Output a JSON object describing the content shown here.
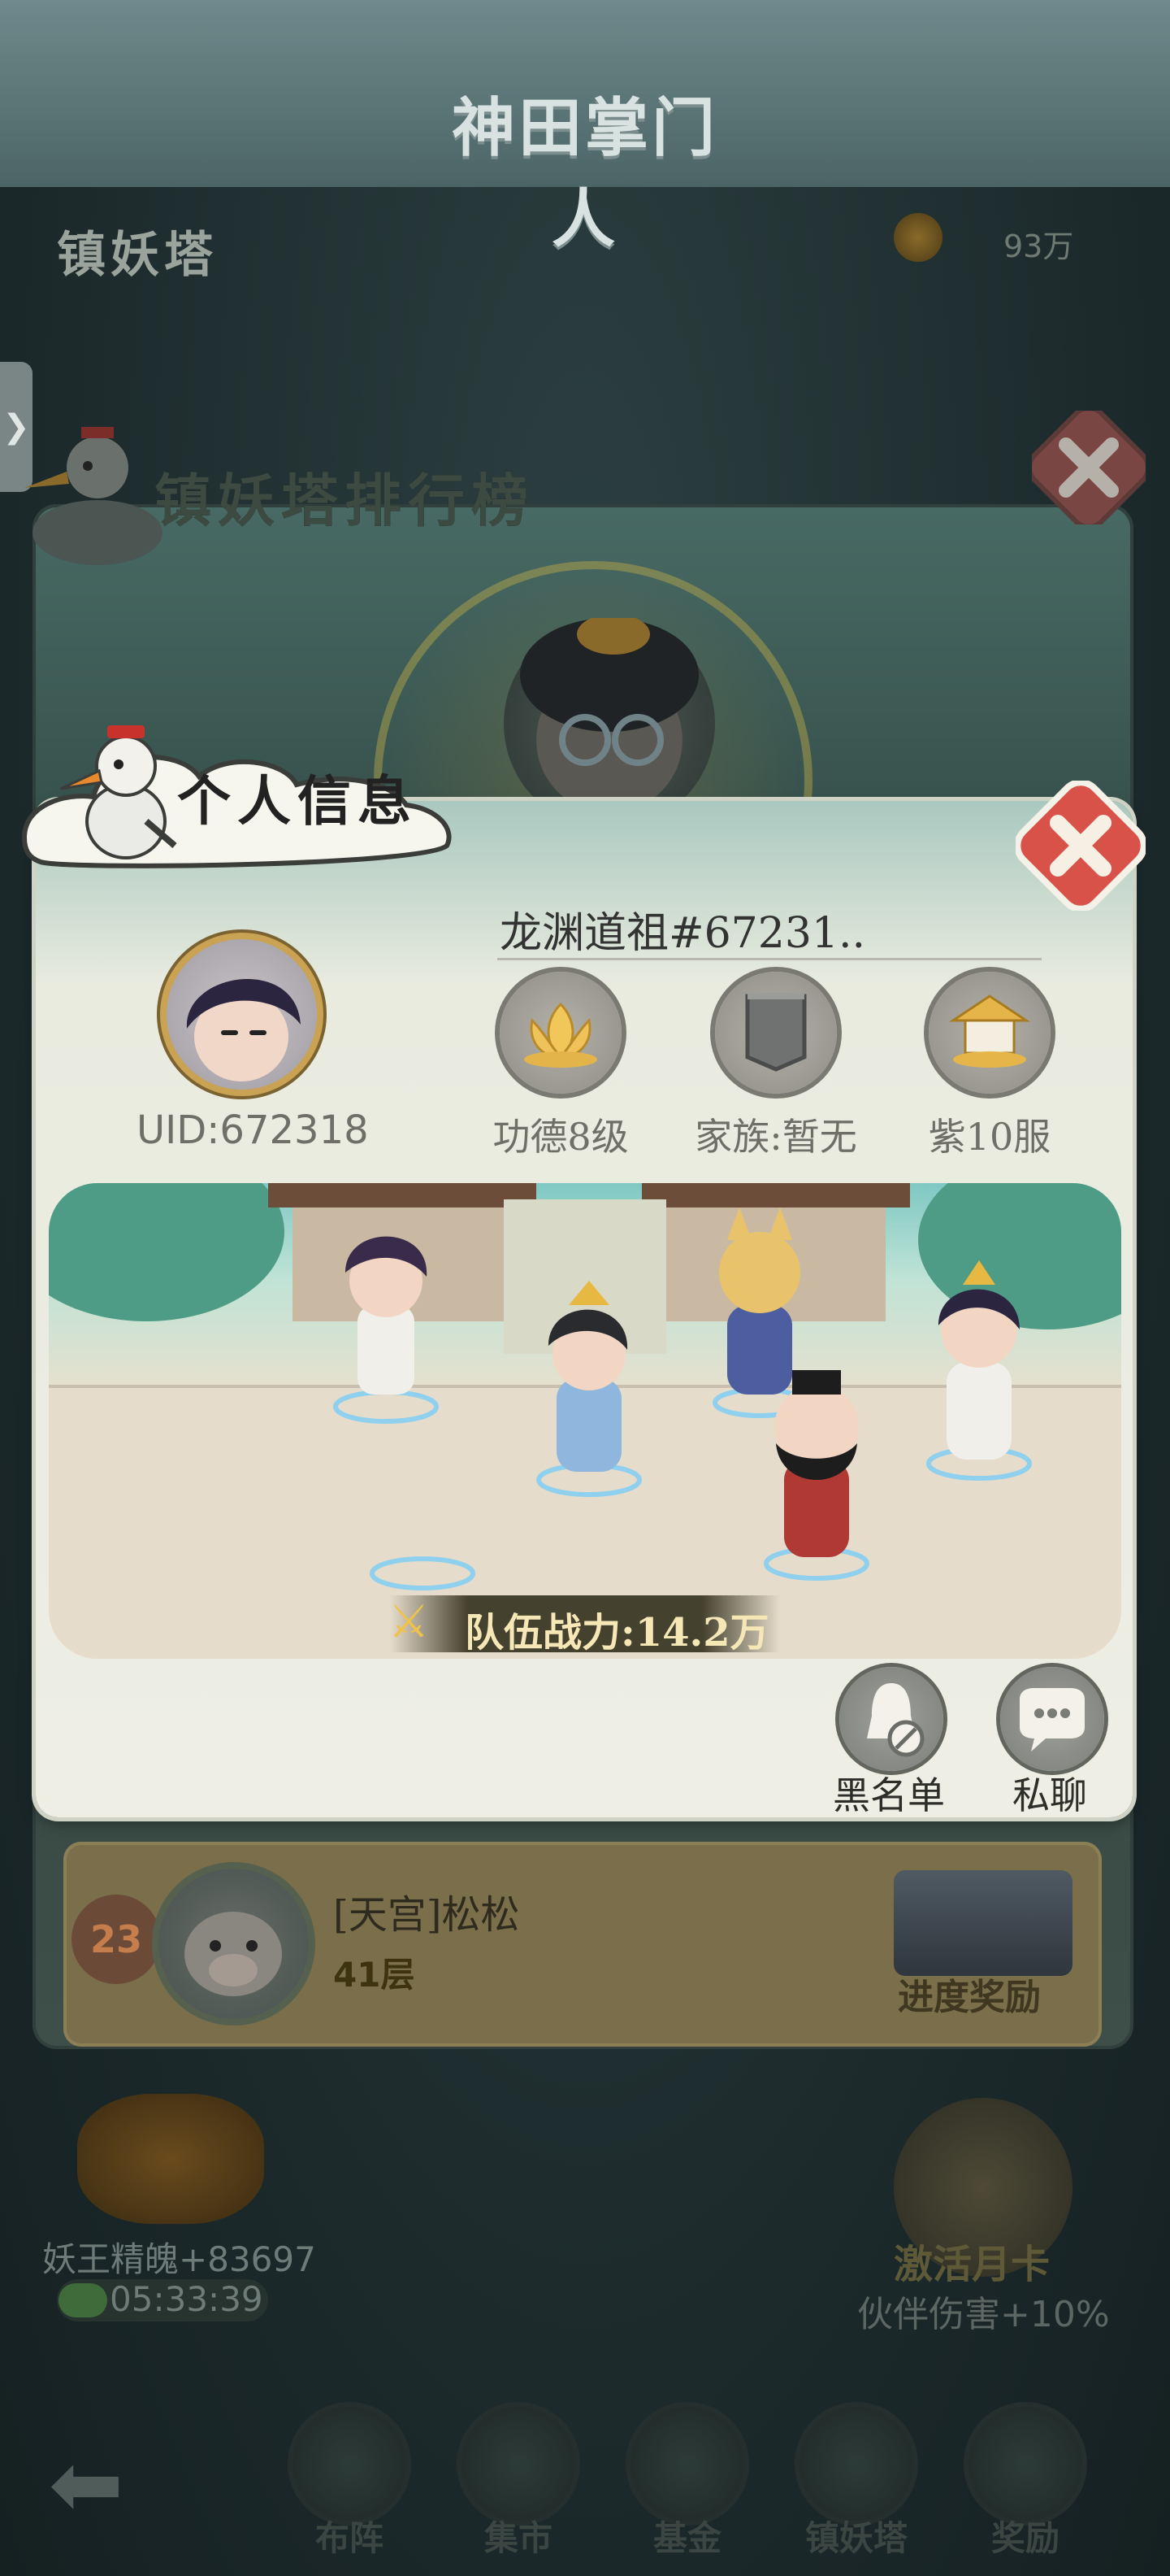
{
  "background": {
    "game_logo": "神田掌门人",
    "tower_title": "镇妖塔",
    "currency_value": "93万",
    "left_tab_glyph": "❯"
  },
  "rank_panel": {
    "title": "镇妖塔排行榜",
    "row": {
      "rank": "23",
      "player_name": "[天宫]松松",
      "floor": "41层",
      "progress_reward_label": "进度奖励"
    }
  },
  "hud": {
    "demon_essence": "妖王精魄+83697",
    "timer": "05:33:39",
    "monthcard_title": "激活月卡",
    "monthcard_bonus": "伙伴伤害+10%",
    "back_glyph": "⬅",
    "nav": [
      {
        "label": "布阵"
      },
      {
        "label": "集市"
      },
      {
        "label": "基金"
      },
      {
        "label": "镇妖塔"
      },
      {
        "label": "奖励"
      }
    ]
  },
  "dialog": {
    "title": "个人信息",
    "player_name": "龙渊道祖#67231..",
    "uid": "UID:672318",
    "merit": "功德8级",
    "clan": "家族:暂无",
    "server": "紫10服",
    "team_power": "队伍战力:14.2万",
    "power_icon_glyph": "⚔",
    "actions": {
      "blacklist": "黑名单",
      "private_chat": "私聊"
    }
  },
  "colors": {
    "close_button": "#d9524a",
    "dialog_bg": "#eeeee4",
    "power_text": "#f6e7b7"
  }
}
